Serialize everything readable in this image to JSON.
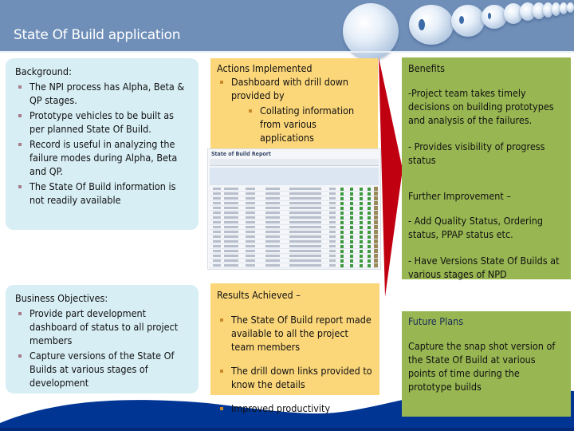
{
  "header": {
    "title": "State Of Build application"
  },
  "background": {
    "heading": "Background:",
    "items": [
      "The  NPI process has Alpha, Beta & QP stages.",
      "Prototype vehicles to be  built  as per planned State Of Build.",
      "Record is useful in analyzing the failure modes during Alpha, Beta and QP.",
      "The State Of Build information is not readily available"
    ]
  },
  "business_objectives": {
    "heading": "Business Objectives:",
    "items": [
      "Provide part development dashboard of status to all project members",
      "Capture versions of the State Of Builds at various stages of development"
    ]
  },
  "actions": {
    "heading": "Actions Implemented",
    "item": "Dashboard with drill down provided by",
    "subitem": "Collating information from various applications"
  },
  "report_thumbnail": {
    "title": "State of Build Report"
  },
  "results": {
    "heading": "Results Achieved –",
    "items": [
      "The  State Of Build report made available  to all the project team members",
      "The drill down links provided to know the details",
      "Improved productivity"
    ]
  },
  "benefits": {
    "heading": "Benefits",
    "points": [
      "-Project team takes timely decisions on building prototypes and  analysis of the failures.",
      "- Provides visibility of progress status"
    ],
    "further_heading": "Further Improvement –",
    "further_points": [
      "- Add Quality Status, Ordering status, PPAP status etc.",
      "- Have Versions State Of Builds at various stages of NPD"
    ]
  },
  "future_plans": {
    "heading": "Future Plans",
    "text": "Capture the snap shot version  of the State Of Build at various points of time during the prototype builds"
  },
  "colors": {
    "header_bg": "#6f8fb8",
    "blue_panel": "#d7eef5",
    "yellow_panel": "#fcd77a",
    "green_panel": "#98b752",
    "arrow": "#c00010",
    "wave": "#003594"
  }
}
